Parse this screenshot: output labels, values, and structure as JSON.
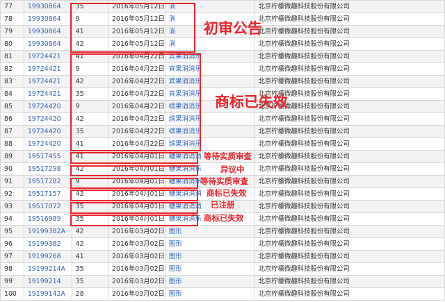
{
  "table": {
    "rows": [
      {
        "no": "77",
        "reg": "19930864",
        "cls": "35",
        "date": "2016年05月12日",
        "name": "淌",
        "owner": "北京柠檬微趣科技股份有限公司"
      },
      {
        "no": "78",
        "reg": "19930864",
        "cls": "9",
        "date": "2016年05月12日",
        "name": "淌",
        "owner": "北京柠檬微趣科技股份有限公司"
      },
      {
        "no": "79",
        "reg": "19930864",
        "cls": "41",
        "date": "2016年05月12日",
        "name": "淌",
        "owner": "北京柠檬微趣科技股份有限公司"
      },
      {
        "no": "80",
        "reg": "19930864",
        "cls": "42",
        "date": "2016年05月12日",
        "name": "淌",
        "owner": "北京柠檬微趣科技股份有限公司"
      },
      {
        "no": "81",
        "reg": "19724421",
        "cls": "41",
        "date": "2016年04月22日",
        "name": "宾果消消乐",
        "owner": "北京柠檬微趣科技股份有限公司"
      },
      {
        "no": "82",
        "reg": "19724421",
        "cls": "9",
        "date": "2016年04月22日",
        "name": "宾果消消乐",
        "owner": "北京柠檬微趣科技股份有限公司"
      },
      {
        "no": "83",
        "reg": "19724421",
        "cls": "42",
        "date": "2016年04月22日",
        "name": "宾果消消乐",
        "owner": "北京柠檬微趣科技股份有限公司"
      },
      {
        "no": "84",
        "reg": "19724421",
        "cls": "35",
        "date": "2016年04月22日",
        "name": "宾果消消乐",
        "owner": "北京柠檬微趣科技股份有限公司"
      },
      {
        "no": "85",
        "reg": "19724420",
        "cls": "9",
        "date": "2016年04月22日",
        "name": "缤果消消乐",
        "owner": "北京柠檬微趣科技股份有限公司"
      },
      {
        "no": "86",
        "reg": "19724420",
        "cls": "42",
        "date": "2016年04月22日",
        "name": "缤果消消乐",
        "owner": "北京柠檬微趣科技股份有限公司"
      },
      {
        "no": "87",
        "reg": "19724420",
        "cls": "35",
        "date": "2016年04月22日",
        "name": "缤果消消乐",
        "owner": "北京柠檬微趣科技股份有限公司"
      },
      {
        "no": "88",
        "reg": "19724420",
        "cls": "41",
        "date": "2016年04月22日",
        "name": "缤果消消乐",
        "owner": "北京柠檬微趣科技股份有限公司"
      },
      {
        "no": "89",
        "reg": "19517455",
        "cls": "41",
        "date": "2016年04月01日",
        "name": "糖果消消消",
        "owner": "北京柠檬微趣科技股份有限公司"
      },
      {
        "no": "90",
        "reg": "19517298",
        "cls": "42",
        "date": "2016年04月01日",
        "name": "糖果消消乐",
        "owner": "北京柠檬微趣科技股份有限公司"
      },
      {
        "no": "91",
        "reg": "19517282",
        "cls": "9",
        "date": "2016年04月01日",
        "name": "糖果消消乐",
        "owner": "北京柠檬微趣科技股份有限公司"
      },
      {
        "no": "92",
        "reg": "19517157",
        "cls": "42",
        "date": "2016年04月01日",
        "name": "糖果消消消",
        "owner": "北京柠檬微趣科技股份有限公司"
      },
      {
        "no": "93",
        "reg": "19517072",
        "cls": "35",
        "date": "2016年04月01日",
        "name": "糖果消消消",
        "owner": "北京柠檬微趣科技股份有限公司"
      },
      {
        "no": "94",
        "reg": "19516989",
        "cls": "35",
        "date": "2016年04月01日",
        "name": "糖果消消乐",
        "owner": "北京柠檬微趣科技股份有限公司"
      },
      {
        "no": "95",
        "reg": "19199382A",
        "cls": "42",
        "date": "2016年03月02日",
        "name": "图形",
        "owner": "北京柠檬微趣科技股份有限公司"
      },
      {
        "no": "96",
        "reg": "19199382",
        "cls": "42",
        "date": "2016年03月02日",
        "name": "图形",
        "owner": "北京柠檬微趣科技股份有限公司"
      },
      {
        "no": "97",
        "reg": "19199268",
        "cls": "41",
        "date": "2016年03月02日",
        "name": "图形",
        "owner": "北京柠檬微趣科技股份有限公司"
      },
      {
        "no": "98",
        "reg": "19199214A",
        "cls": "35",
        "date": "2016年03月02日",
        "name": "图形",
        "owner": "北京柠檬微趣科技股份有限公司"
      },
      {
        "no": "99",
        "reg": "19199214",
        "cls": "35",
        "date": "2016年03月02日",
        "name": "图形",
        "owner": "北京柠檬微趣科技股份有限公司"
      },
      {
        "no": "100",
        "reg": "19199142A",
        "cls": "28",
        "date": "2016年03月02日",
        "name": "图形",
        "owner": "北京柠檬微趣科技股份有限公司"
      }
    ]
  },
  "annotations": {
    "preliminary": "初审公告",
    "invalid_big": "商标已失效",
    "pending_1": "等待实质审查",
    "objection": "异议中",
    "pending_2": "等待实质审查",
    "invalid_small": "商标已失效",
    "registered": "已注册",
    "invalid_last": "商标已失效"
  },
  "colors": {
    "annotation": "#e8262b",
    "link": "#2f62b8",
    "row_alt": "#f3f3f3",
    "grid": "#d6d6d6"
  }
}
